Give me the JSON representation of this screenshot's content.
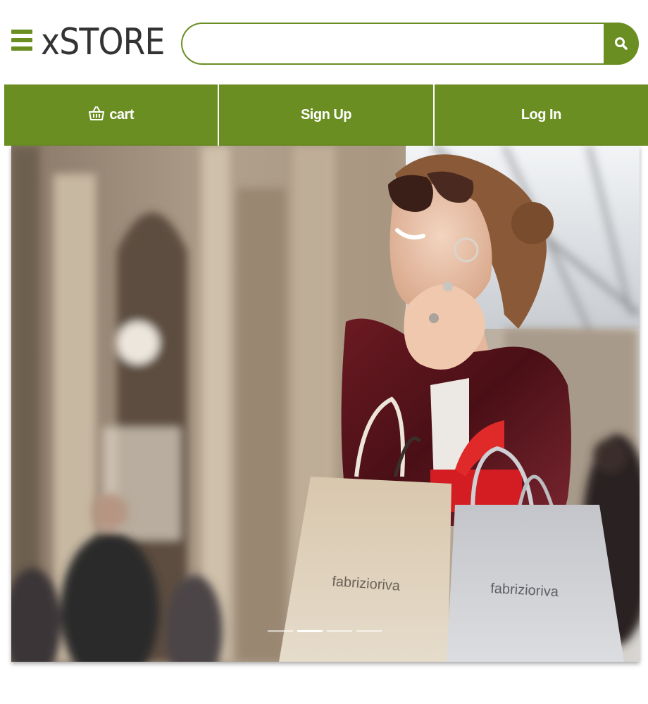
{
  "header": {
    "logo_text": "xSTORE",
    "menu_icon": "hamburger-menu-icon",
    "search": {
      "value": "",
      "placeholder": "",
      "button_icon": "search-icon"
    }
  },
  "nav": {
    "cart_label": "cart",
    "cart_icon": "shopping-basket-icon",
    "signup_label": "Sign Up",
    "login_label": "Log In"
  },
  "hero": {
    "bag_brand": "fabrizioriva",
    "carousel": {
      "slide_count": 4,
      "active_index": 1
    }
  },
  "colors": {
    "accent": "#6b8e23",
    "logo": "#333333",
    "nav_text": "#ffffff"
  }
}
